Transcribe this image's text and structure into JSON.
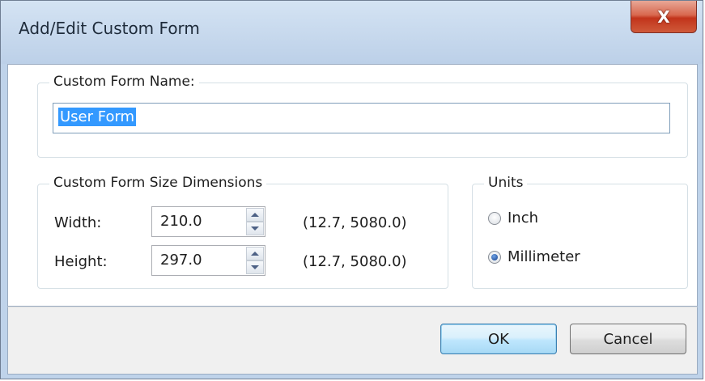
{
  "window": {
    "title": "Add/Edit Custom Form",
    "close_glyph": "X"
  },
  "name_group": {
    "legend": "Custom Form Name:",
    "value": "User Form"
  },
  "size_group": {
    "legend": "Custom Form Size Dimensions",
    "width": {
      "label": "Width:",
      "value": "210.0",
      "range": "(12.7, 5080.0)"
    },
    "height": {
      "label": "Height:",
      "value": "297.0",
      "range": "(12.7, 5080.0)"
    }
  },
  "units_group": {
    "legend": "Units",
    "options": [
      {
        "label": "Inch",
        "selected": false
      },
      {
        "label": "Millimeter",
        "selected": true
      }
    ]
  },
  "footer": {
    "ok_label": "OK",
    "cancel_label": "Cancel"
  },
  "icons": {
    "close": "close-icon",
    "spin_up": "spin-up-arrow-icon",
    "spin_down": "spin-down-arrow-icon"
  },
  "colors": {
    "selection": "#3399ff",
    "close_button": "#c2341b",
    "default_button_border": "#3c7fb1"
  }
}
